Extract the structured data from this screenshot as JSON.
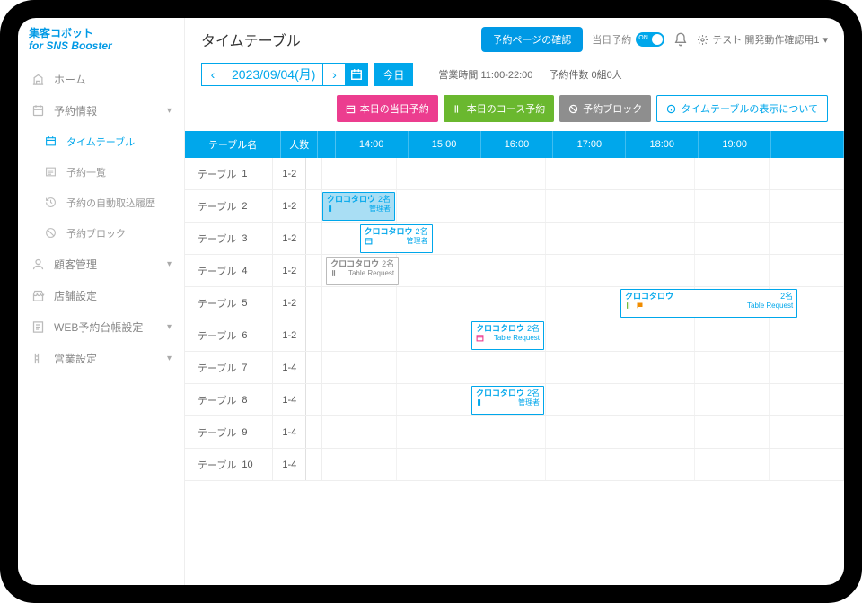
{
  "logo": {
    "line1": "集客コボット",
    "line2": "for SNS Booster"
  },
  "sidebar": {
    "items": [
      {
        "label": "ホーム"
      },
      {
        "label": "予約情報"
      },
      {
        "label": "タイムテーブル"
      },
      {
        "label": "予約一覧"
      },
      {
        "label": "予約の自動取込履歴"
      },
      {
        "label": "予約ブロック"
      },
      {
        "label": "顧客管理"
      },
      {
        "label": "店舗設定"
      },
      {
        "label": "WEB予約台帳設定"
      },
      {
        "label": "営業設定"
      }
    ]
  },
  "header": {
    "page_title": "タイムテーブル",
    "confirm_btn": "予約ページの確認",
    "today_res_label": "当日予約",
    "toggle_text": "ON",
    "user_label": "テスト 開発動作確認用1"
  },
  "datebar": {
    "date": "2023/09/04(月)",
    "today_btn": "今日",
    "biz_hours_label": "営業時間 11:00-22:00",
    "reservation_count": "予約件数 0組0人"
  },
  "actions": {
    "same_day": "本日の当日予約",
    "course": "本日のコース予約",
    "block": "予約ブロック",
    "about": "タイムテーブルの表示について"
  },
  "timetable": {
    "col_name": "テーブル名",
    "col_cap": "人数",
    "hours": [
      "14:00",
      "15:00",
      "16:00",
      "17:00",
      "18:00",
      "19:00"
    ],
    "rows": [
      {
        "name": "テーブル",
        "index": "1",
        "cap": "1-2"
      },
      {
        "name": "テーブル",
        "index": "2",
        "cap": "1-2"
      },
      {
        "name": "テーブル",
        "index": "3",
        "cap": "1-2"
      },
      {
        "name": "テーブル",
        "index": "4",
        "cap": "1-2"
      },
      {
        "name": "テーブル",
        "index": "5",
        "cap": "1-2"
      },
      {
        "name": "テーブル",
        "index": "6",
        "cap": "1-2"
      },
      {
        "name": "テーブル",
        "index": "7",
        "cap": "1-4"
      },
      {
        "name": "テーブル",
        "index": "8",
        "cap": "1-4"
      },
      {
        "name": "テーブル",
        "index": "9",
        "cap": "1-4"
      },
      {
        "name": "テーブル",
        "index": "10",
        "cap": "1-4"
      }
    ]
  },
  "bookings": {
    "b1": {
      "name": "クロコタロウ",
      "count": "2名",
      "sub": "管理者"
    },
    "b2": {
      "name": "クロコタロウ",
      "count": "2名",
      "sub": "管理者"
    },
    "b3": {
      "name": "クロコタロウ",
      "count": "2名",
      "sub": "Table Request"
    },
    "b4": {
      "name": "クロコタロウ",
      "count": "2名",
      "sub": "Table Request"
    },
    "b5": {
      "name": "クロコタロウ",
      "count": "2名",
      "sub": "Table Request"
    },
    "b6": {
      "name": "クロコタロウ",
      "count": "2名",
      "sub": "管理者"
    }
  }
}
